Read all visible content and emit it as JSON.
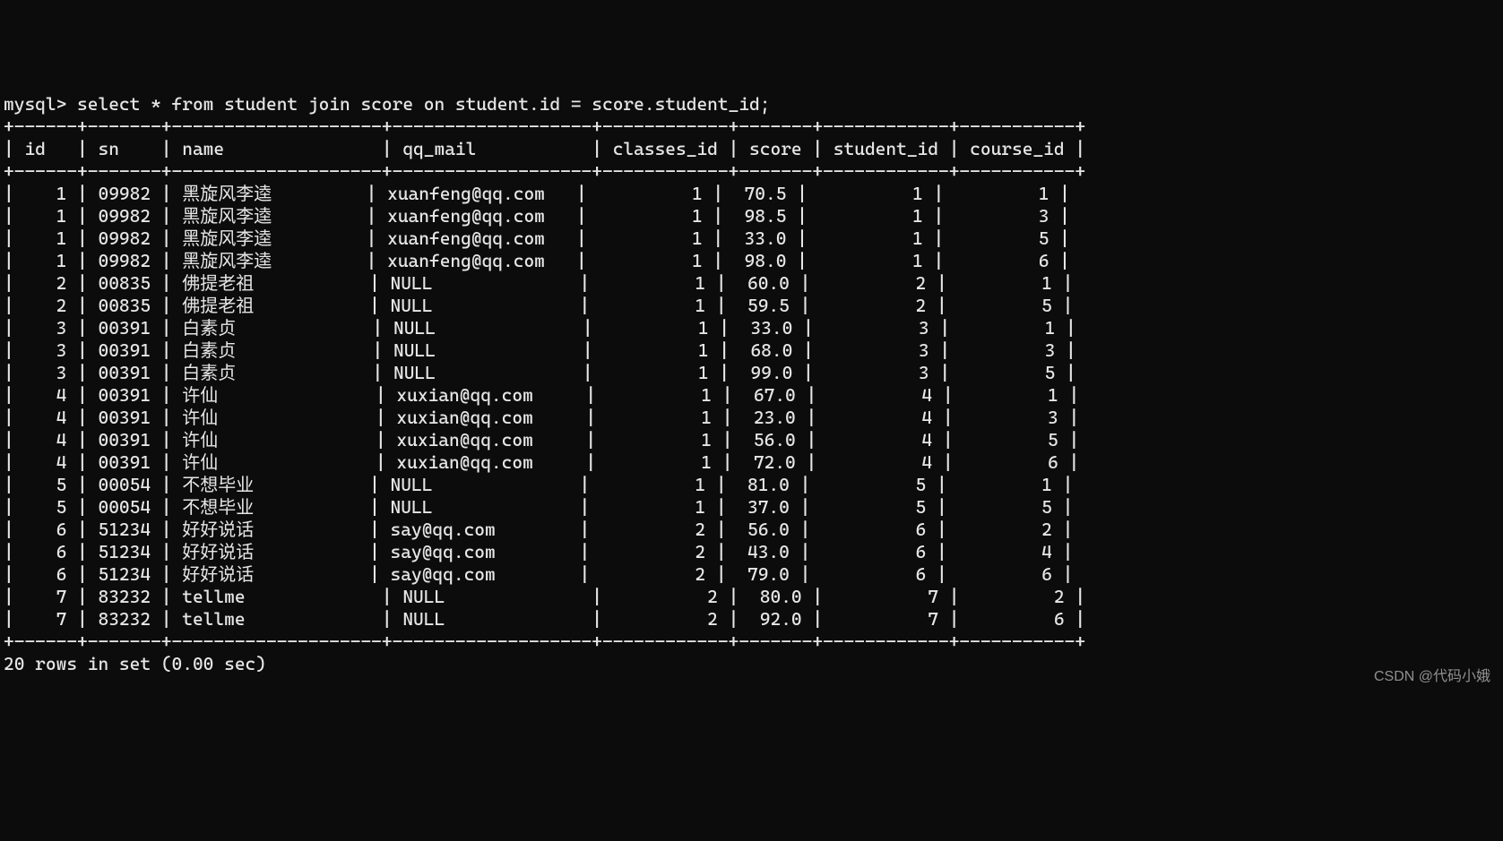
{
  "prompt_prefix": "mysql> ",
  "query": "select * from student join score on student.id = score.student_id;",
  "columns": [
    {
      "name": "id",
      "width": 4,
      "align": "right",
      "pad_right": " "
    },
    {
      "name": "sn",
      "width": 5,
      "align": "left",
      "pad_right": " "
    },
    {
      "name": "name",
      "width": 18,
      "align": "left",
      "pad_right": " "
    },
    {
      "name": "qq_mail",
      "width": 17,
      "align": "left",
      "pad_right": " "
    },
    {
      "name": "classes_id",
      "width": 10,
      "align": "right",
      "pad_right": " "
    },
    {
      "name": "score",
      "width": 5,
      "align": "right",
      "pad_right": " "
    },
    {
      "name": "student_id",
      "width": 10,
      "align": "right",
      "pad_right": " "
    },
    {
      "name": "course_id",
      "width": 9,
      "align": "right",
      "pad_right": " "
    }
  ],
  "rows": [
    [
      "1",
      "09982",
      "黑旋风李逵",
      "xuanfeng@qq.com",
      "1",
      "70.5",
      "1",
      "1"
    ],
    [
      "1",
      "09982",
      "黑旋风李逵",
      "xuanfeng@qq.com",
      "1",
      "98.5",
      "1",
      "3"
    ],
    [
      "1",
      "09982",
      "黑旋风李逵",
      "xuanfeng@qq.com",
      "1",
      "33.0",
      "1",
      "5"
    ],
    [
      "1",
      "09982",
      "黑旋风李逵",
      "xuanfeng@qq.com",
      "1",
      "98.0",
      "1",
      "6"
    ],
    [
      "2",
      "00835",
      "佛提老祖",
      "NULL",
      "1",
      "60.0",
      "2",
      "1"
    ],
    [
      "2",
      "00835",
      "佛提老祖",
      "NULL",
      "1",
      "59.5",
      "2",
      "5"
    ],
    [
      "3",
      "00391",
      "白素贞",
      "NULL",
      "1",
      "33.0",
      "3",
      "1"
    ],
    [
      "3",
      "00391",
      "白素贞",
      "NULL",
      "1",
      "68.0",
      "3",
      "3"
    ],
    [
      "3",
      "00391",
      "白素贞",
      "NULL",
      "1",
      "99.0",
      "3",
      "5"
    ],
    [
      "4",
      "00391",
      "许仙",
      "xuxian@qq.com",
      "1",
      "67.0",
      "4",
      "1"
    ],
    [
      "4",
      "00391",
      "许仙",
      "xuxian@qq.com",
      "1",
      "23.0",
      "4",
      "3"
    ],
    [
      "4",
      "00391",
      "许仙",
      "xuxian@qq.com",
      "1",
      "56.0",
      "4",
      "5"
    ],
    [
      "4",
      "00391",
      "许仙",
      "xuxian@qq.com",
      "1",
      "72.0",
      "4",
      "6"
    ],
    [
      "5",
      "00054",
      "不想毕业",
      "NULL",
      "1",
      "81.0",
      "5",
      "1"
    ],
    [
      "5",
      "00054",
      "不想毕业",
      "NULL",
      "1",
      "37.0",
      "5",
      "5"
    ],
    [
      "6",
      "51234",
      "好好说话",
      "say@qq.com",
      "2",
      "56.0",
      "6",
      "2"
    ],
    [
      "6",
      "51234",
      "好好说话",
      "say@qq.com",
      "2",
      "43.0",
      "6",
      "4"
    ],
    [
      "6",
      "51234",
      "好好说话",
      "say@qq.com",
      "2",
      "79.0",
      "6",
      "6"
    ],
    [
      "7",
      "83232",
      "tellme",
      "NULL",
      "2",
      "80.0",
      "7",
      "2"
    ],
    [
      "7",
      "83232",
      "tellme",
      "NULL",
      "2",
      "92.0",
      "7",
      "6"
    ]
  ],
  "footer": "20 rows in set (0.00 sec)",
  "watermark": "CSDN @代码小娥"
}
